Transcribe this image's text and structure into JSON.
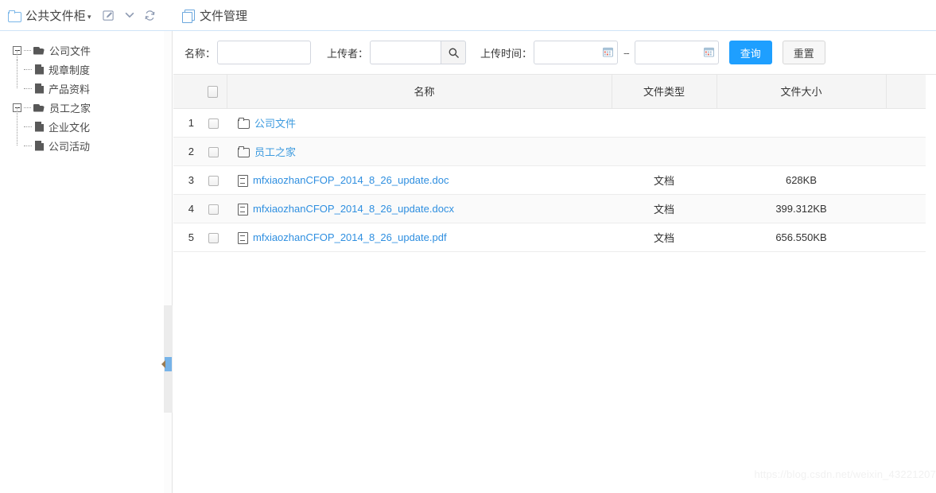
{
  "sidebar": {
    "title": "公共文件柜",
    "title_icon": "folder-outline-icon",
    "caret": "▾",
    "tools": [
      {
        "name": "edit-icon",
        "label": "编辑"
      },
      {
        "name": "chevron-down-icon",
        "label": "展开"
      },
      {
        "name": "refresh-icon",
        "label": "刷新"
      }
    ],
    "tree": [
      {
        "label": "公司文件",
        "icon": "folder-open-icon",
        "toggle": "minus-box-icon",
        "children": [
          {
            "label": "规章制度",
            "icon": "file-icon"
          },
          {
            "label": "产品资料",
            "icon": "file-icon"
          }
        ]
      },
      {
        "label": "员工之家",
        "icon": "folder-open-icon",
        "toggle": "minus-box-icon",
        "children": [
          {
            "label": "企业文化",
            "icon": "file-icon"
          },
          {
            "label": "公司活动",
            "icon": "file-icon"
          }
        ]
      }
    ]
  },
  "main": {
    "title": "文件管理",
    "title_icon": "pages-icon",
    "filters": {
      "name_label": "名称：",
      "name_value": "",
      "name_placeholder": "",
      "uploader_label": "上传者：",
      "uploader_value": "",
      "uploader_placeholder": "",
      "search_icon": "search-icon",
      "date_label": "上传时间：",
      "date_start_value": "",
      "date_start_placeholder": "",
      "date_end_value": "",
      "date_end_placeholder": "",
      "date_separator": "--",
      "calendar_icon": "calendar-icon",
      "query_button": "查询",
      "reset_button": "重置"
    },
    "table": {
      "headers": {
        "index": "",
        "checkbox": "select-all",
        "name": "名称",
        "type": "文件类型",
        "size": "文件大小",
        "last": ""
      },
      "rows": [
        {
          "index": "1",
          "icon": "folder-icon",
          "name": "公司文件",
          "type": "",
          "size": ""
        },
        {
          "index": "2",
          "icon": "folder-icon",
          "name": "员工之家",
          "type": "",
          "size": ""
        },
        {
          "index": "3",
          "icon": "file-icon",
          "name": "mfxiaozhanCFOP_2014_8_26_update.doc",
          "type": "文档",
          "size": "628KB"
        },
        {
          "index": "4",
          "icon": "file-icon",
          "name": "mfxiaozhanCFOP_2014_8_26_update.docx",
          "type": "文档",
          "size": "399.312KB"
        },
        {
          "index": "5",
          "icon": "file-icon",
          "name": "mfxiaozhanCFOP_2014_8_26_update.pdf",
          "type": "文档",
          "size": "656.550KB"
        }
      ]
    }
  },
  "watermark": "https://blog.csdn.net/weixin_43221207",
  "colors": {
    "accent": "#1e9fff",
    "link": "#2f8fe0",
    "divider": "#cfe4f7",
    "header_bg": "#f5f5f5",
    "row_alt_bg": "#fafafa"
  }
}
